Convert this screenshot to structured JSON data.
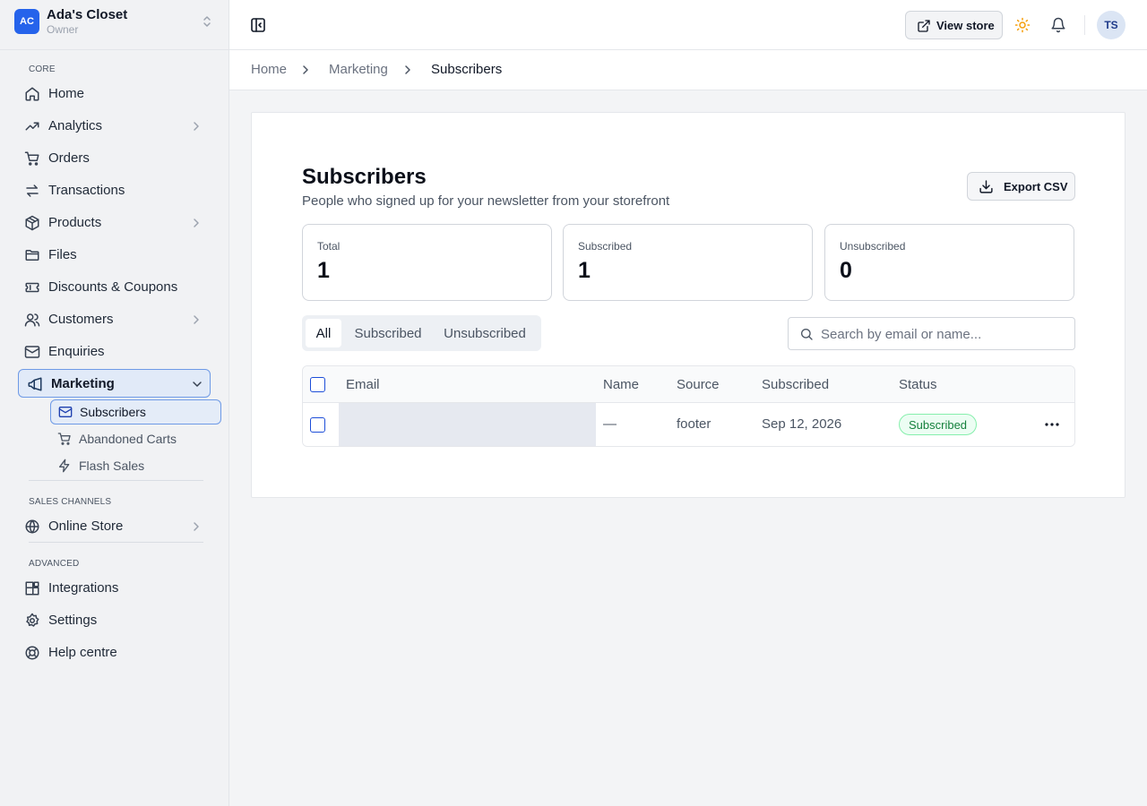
{
  "store": {
    "initials": "AC",
    "name": "Ada's Closet",
    "role": "Owner"
  },
  "sidebar": {
    "sections": {
      "core": "CORE",
      "sales_channels": "SALES CHANNELS",
      "advanced": "ADVANCED"
    },
    "items": {
      "home": "Home",
      "analytics": "Analytics",
      "orders": "Orders",
      "transactions": "Transactions",
      "products": "Products",
      "files": "Files",
      "discounts": "Discounts & Coupons",
      "customers": "Customers",
      "enquiries": "Enquiries",
      "marketing": "Marketing",
      "online_store": "Online Store",
      "integrations": "Integrations",
      "settings": "Settings",
      "help": "Help centre"
    },
    "marketing_sub": {
      "subscribers": "Subscribers",
      "abandoned_carts": "Abandoned Carts",
      "flash_sales": "Flash Sales"
    }
  },
  "topbar": {
    "view_store": "View store",
    "user_initials": "TS"
  },
  "breadcrumb": [
    "Home",
    "Marketing",
    "Subscribers"
  ],
  "page": {
    "title": "Subscribers",
    "subtitle": "People who signed up for your newsletter from your storefront",
    "export_label": "Export CSV"
  },
  "stats": [
    {
      "label": "Total",
      "value": "1"
    },
    {
      "label": "Subscribed",
      "value": "1"
    },
    {
      "label": "Unsubscribed",
      "value": "0"
    }
  ],
  "tabs": [
    "All",
    "Subscribed",
    "Unsubscribed"
  ],
  "active_tab": "All",
  "search": {
    "placeholder": "Search by email or name..."
  },
  "table": {
    "columns": [
      "Email",
      "Name",
      "Source",
      "Subscribed",
      "Status"
    ],
    "rows": [
      {
        "email": "",
        "name": "—",
        "source": "footer",
        "subscribed": "Sep 12, 2026",
        "status": "Subscribed"
      }
    ]
  },
  "colors": {
    "accent": "#2563eb",
    "status_green": "#15803d",
    "sun": "#f59e0b"
  }
}
